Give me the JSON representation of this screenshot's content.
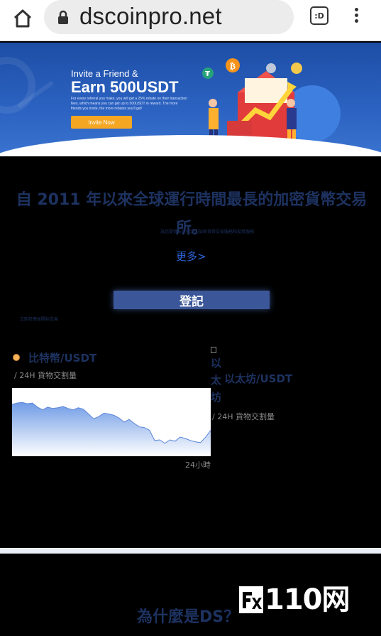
{
  "browser": {
    "url": "dscoinpro.net",
    "tab_count": ":D"
  },
  "banner": {
    "title": "Invite a Friend &",
    "headline": "Earn 500USDT",
    "body": "For every referral you make, you will get a 25% rebate on their transaction fees, which means you can get up to 500USDT in reward. The more friends you invite, the more rebates you'll get!",
    "button": "Invite Now"
  },
  "hero": {
    "title": "自 2011 年以來全球運行時間最長的加密貨幣交易所。",
    "subtitle": "為您提供安全穩定的加密貨幣交易服務和投資服務",
    "more_link": "更多>",
    "register_button": "登記",
    "register_note": "立即註冊並開始交易"
  },
  "markets": [
    {
      "pair": "比特幣/USDT",
      "volume_label": "/ 24H 貨物交割量",
      "range_label": "24小時"
    },
    {
      "icon_alt": "以太坊",
      "pair": "以太坊/USDT",
      "volume_label": "/ 24H 貨物交割量"
    }
  ],
  "chart_data": {
    "type": "area",
    "title": "",
    "xlabel": "",
    "ylabel": "",
    "x": [
      0,
      1,
      2,
      3,
      4,
      5,
      6,
      7,
      8,
      9,
      10,
      11,
      12,
      13,
      14,
      15,
      16,
      17,
      18,
      19,
      20,
      21,
      22,
      23,
      24,
      25,
      26,
      27,
      28,
      29,
      30,
      31,
      32,
      33,
      34,
      35,
      36,
      37,
      38,
      39
    ],
    "y": [
      76,
      78,
      79,
      77,
      78,
      72,
      68,
      72,
      70,
      71,
      73,
      70,
      68,
      71,
      69,
      62,
      55,
      58,
      63,
      62,
      60,
      56,
      50,
      54,
      48,
      43,
      42,
      38,
      23,
      24,
      19,
      24,
      22,
      28,
      26,
      23,
      21,
      20,
      28,
      38
    ],
    "ylim": [
      0,
      100
    ],
    "grid": false,
    "colors": {
      "stroke": "#5b86d8",
      "fill_top": "#6f9be6",
      "fill_bottom": "#ffffff"
    }
  },
  "bottom": {
    "why_title": "為什麼是DS？"
  },
  "watermark": {
    "text": "110网",
    "logo": "FX"
  },
  "colors": {
    "page_bg": "#000000",
    "text_dark_blue": "#1d3260",
    "link_blue": "#2d64d8",
    "button_blue": "#3b5799"
  }
}
